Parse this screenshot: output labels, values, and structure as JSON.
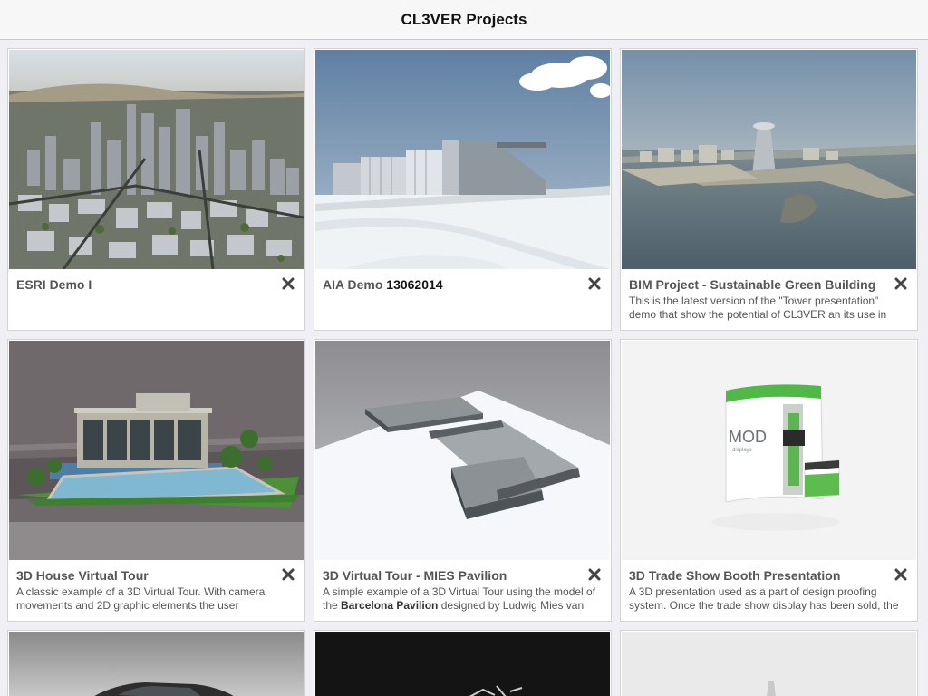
{
  "app": {
    "title": "CL3VER Projects"
  },
  "projects": [
    {
      "name": "ESRI Demo I",
      "description": ""
    },
    {
      "name_prefix": "AIA Demo ",
      "name_bold": "13062014",
      "description": ""
    },
    {
      "name": "BIM Project - Sustainable Green Building",
      "description": "This is the latest version of the \"Tower presentation\" demo that show the potential of CL3VER an its use in"
    },
    {
      "name": "3D House Virtual Tour",
      "description": "A classic example of a 3D Virtual Tour. With camera movements and 2D graphic elements the user"
    },
    {
      "name": "3D Virtual Tour - MIES Pavilion",
      "desc_prefix": "A simple example of a 3D Virtual Tour using the model of the ",
      "desc_bold": "Barcelona Pavilion",
      "desc_suffix": " designed by Ludwig Mies van"
    },
    {
      "name": "3D Trade Show Booth Presentation",
      "description": "A 3D presentation used as a part of design proofing system. Once the trade show display has been sold, the"
    }
  ],
  "booth_logo": {
    "brand": "MOD",
    "sub": "displays"
  },
  "icons": {
    "close": "close-x-icon"
  },
  "colors": {
    "navbar_bg": "#f7f7f7",
    "card_bg": "#ffffff",
    "page_bg": "#efeff4"
  }
}
